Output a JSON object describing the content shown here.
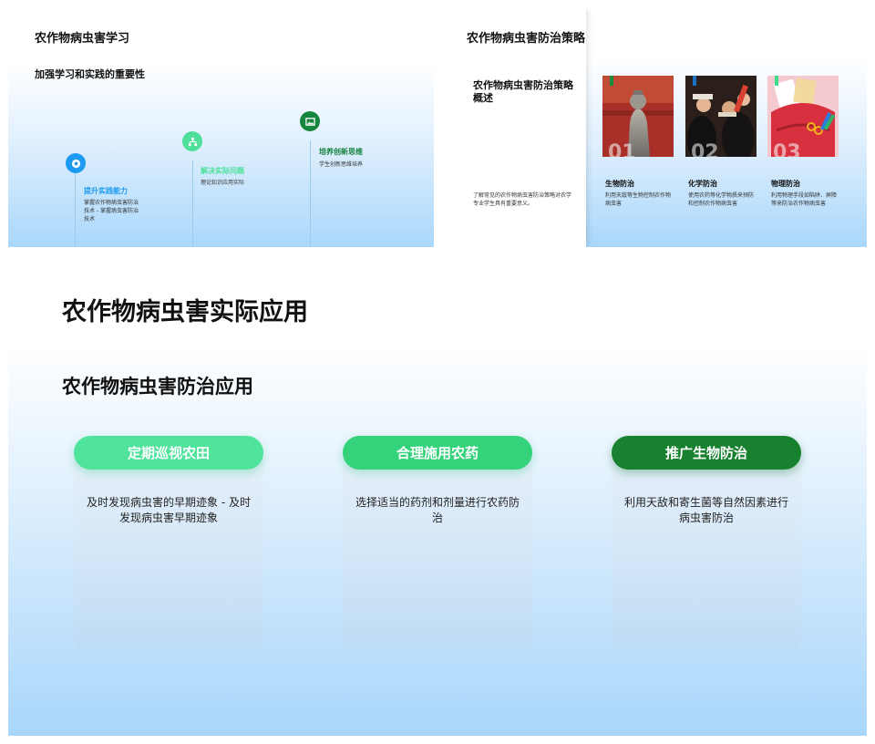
{
  "slide1": {
    "title": "农作物病虫害学习",
    "subtitle": "加强学习和实践的重要性",
    "items": [
      {
        "heading": "提升实践能力",
        "desc": "掌握农作物病虫害防治技术 - 掌握病虫害防治技术",
        "color": "#1e9bf0",
        "icon": "location-icon"
      },
      {
        "heading": "解决实际问题",
        "desc": "理论知识应用实际",
        "color": "#4ee09a",
        "icon": "sitemap-icon"
      },
      {
        "heading": "培养创新思维",
        "desc": "学生创新思维培养",
        "color": "#16853d",
        "icon": "image-icon"
      }
    ]
  },
  "slide2": {
    "title": "农作物病虫害防治策略",
    "overview": "农作物病虫害防治策略概述",
    "intro": "了解常见的农作物病虫害防治策略对农学专业学生具有重要意义。",
    "cards": [
      {
        "num": "01",
        "heading": "生物防治",
        "desc": "利用天敌等生物控制农作物病虫害",
        "tag_color": "#1a8a3c"
      },
      {
        "num": "02",
        "heading": "化学防治",
        "desc": "使用农药等化学物质来预防和控制农作物病虫害",
        "tag_color": "#1a6fc4"
      },
      {
        "num": "03",
        "heading": "物理防治",
        "desc": "利用物理手段如陷阱、屏障等来防治农作物病虫害",
        "tag_color": "#3fdc8a"
      }
    ]
  },
  "slide3": {
    "title": "农作物病虫害实际应用",
    "subtitle": "农作物病虫害防治应用",
    "columns": [
      {
        "label": "定期巡视农田",
        "text": "及时发现病虫害的早期迹象 - 及时发现病虫害早期迹象",
        "color": "#4fe39c"
      },
      {
        "label": "合理施用农药",
        "text": "选择适当的药剂和剂量进行农药防治",
        "color": "#35d27c"
      },
      {
        "label": "推广生物防治",
        "text": "利用天敌和寄生菌等自然因素进行病虫害防治",
        "color": "#17812f"
      }
    ]
  }
}
